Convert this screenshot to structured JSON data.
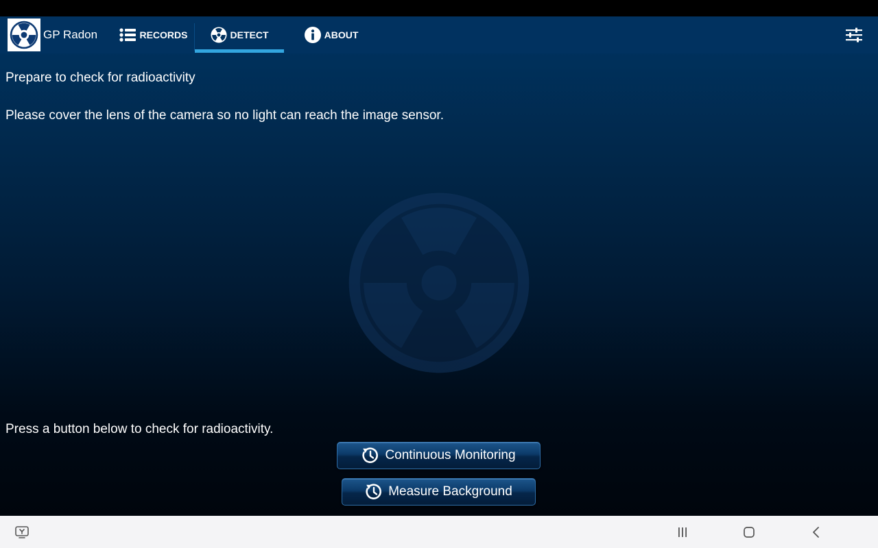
{
  "app": {
    "title": "GP Radon"
  },
  "tabs": {
    "records": "RECORDS",
    "detect": "DETECT",
    "about": "ABOUT",
    "active": "detect"
  },
  "content": {
    "heading": "Prepare to check for radioactivity",
    "instruction": "Please cover the lens of the camera so no light can reach the image sensor.",
    "prompt": "Press a button below to check for radioactivity."
  },
  "buttons": {
    "continuous": "Continuous Monitoring",
    "background": "Measure Background"
  },
  "icons": {
    "logo": "radiation-icon",
    "records": "list-icon",
    "detect": "radiation-icon",
    "about": "info-icon",
    "settings": "sliders-icon",
    "button": "timer-icon"
  },
  "colors": {
    "app_bar": "#013260",
    "tab_indicator": "#33a6e0",
    "background_top": "#003462",
    "background_bottom": "#00050c",
    "nav_bar": "#f4f4f6"
  }
}
